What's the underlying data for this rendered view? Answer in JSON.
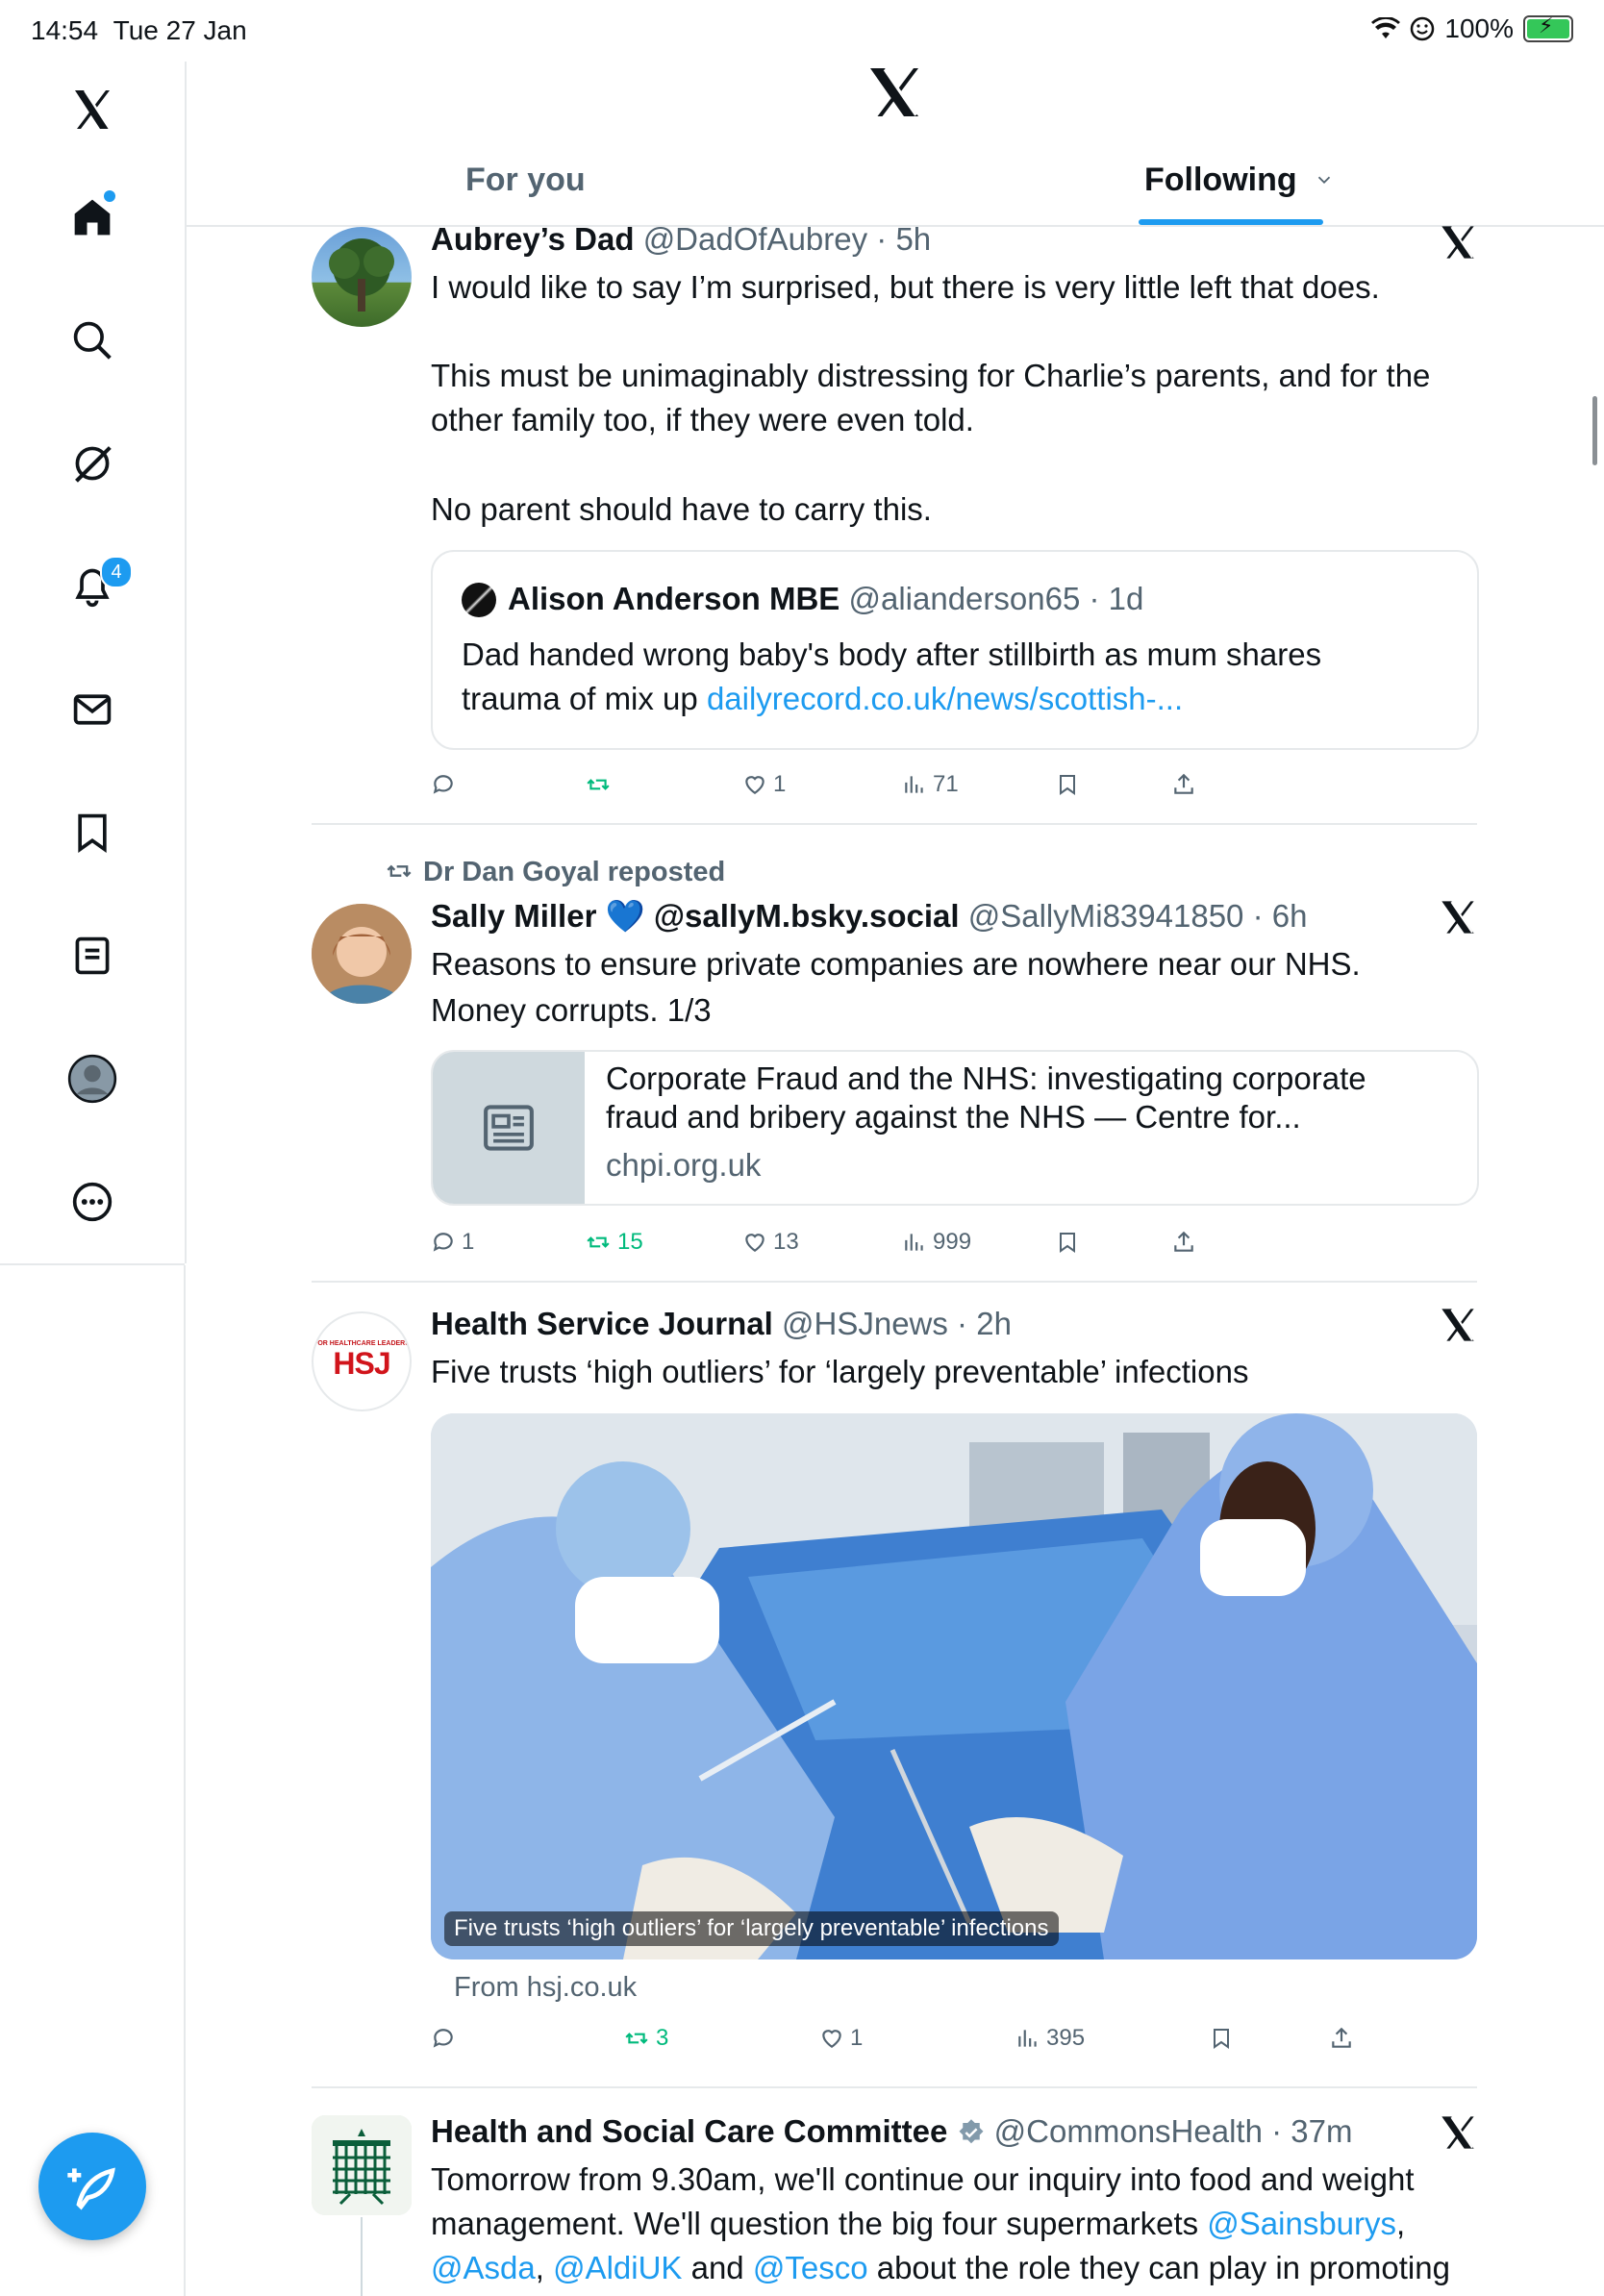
{
  "status_bar": {
    "time": "14:54",
    "date": "Tue 27 Jan",
    "battery": "100%"
  },
  "header": {
    "tabs": [
      "For you",
      "Following"
    ]
  },
  "sidebar": {
    "notifications_badge": "4"
  },
  "tweets": [
    {
      "author": "Aubrey’s Dad",
      "handle": "@DadOfAubrey",
      "time": "5h",
      "lines": [
        "I would like to say I’m surprised, but there is very little left that does.",
        "This must be unimaginably distressing for Charlie’s parents, and for the",
        "other family too, if they were even told.",
        "No parent should have to carry this."
      ],
      "quote": {
        "author": "Alison Anderson MBE",
        "handle": "@alianderson65",
        "time": "1d",
        "line1": "Dad handed wrong baby's body after stillbirth as mum shares",
        "line2": "trauma of mix up ",
        "link": "dailyrecord.co.uk/news/scottish-..."
      },
      "stats": {
        "replies": "",
        "reposts": "",
        "likes": "1",
        "views": "71"
      }
    },
    {
      "reposted_by": "Dr Dan Goyal reposted",
      "author": "Sally Miller 💙 @sallyM.bsky.social",
      "handle": "@SallyMi83941850",
      "time": "6h",
      "lines": [
        "Reasons to ensure private companies are nowhere near our NHS.",
        "Money corrupts. 1/3"
      ],
      "card": {
        "title1": "Corporate Fraud and the NHS: investigating corporate",
        "title2": "fraud and bribery against the NHS — Centre for...",
        "domain": "chpi.org.uk"
      },
      "stats": {
        "replies": "1",
        "reposts": "15",
        "likes": "13",
        "views": "999"
      }
    },
    {
      "author": "Health Service Journal",
      "handle": "@HSJnews",
      "time": "2h",
      "avatar_text": "HSJ",
      "avatar_small": "FOR HEALTHCARE LEADERS",
      "lines": [
        "Five trusts ‘high outliers’ for ‘largely preventable’ infections"
      ],
      "media_caption": "Five trusts ‘high outliers’ for ‘largely preventable’ infections",
      "source": "From hsj.co.uk",
      "stats": {
        "replies": "",
        "reposts": "3",
        "likes": "1",
        "views": "395"
      }
    },
    {
      "author": "Health and Social Care Committee",
      "handle": "@CommonsHealth",
      "time": "37m",
      "line1": "Tomorrow from 9.30am, we'll continue our inquiry into food and weight",
      "line2a": "management. We'll question the big four supermarkets ",
      "mention_sainsburys": "@Sainsburys",
      "comma": ",",
      "mention_asda": "@Asda",
      "sep1": ", ",
      "mention_aldi": "@AldiUK",
      "and": " and ",
      "mention_tesco": "@Tesco",
      "line3_tail": " about the role they can play in promoting"
    }
  ],
  "colors": {
    "accent": "#1d9bf0",
    "repost_green": "#00ba7c",
    "muted": "#536471"
  }
}
